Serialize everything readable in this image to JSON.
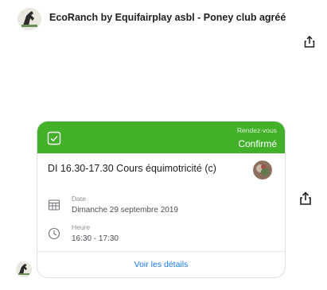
{
  "header": {
    "title": "EcoRanch by Equifairplay asbl - Poney club agréé",
    "logo_icon": "horse-logo-icon"
  },
  "icons": {
    "share_top": "share-icon",
    "share_side": "share-icon",
    "avatar": "horse-logo-icon"
  },
  "card": {
    "accent_color": "#43b02a",
    "rdv_label": "Rendez-vous",
    "status": "Confirmé",
    "title": "DI 16.30-17.30 Cours équimotricité (c)",
    "date_label": "Date",
    "date_value": "Dimanche 29 septembre 2019",
    "time_label": "Heure",
    "time_value": "16:30 - 17:30",
    "details_button": "Voir les détails",
    "link_color": "#1877f2"
  }
}
